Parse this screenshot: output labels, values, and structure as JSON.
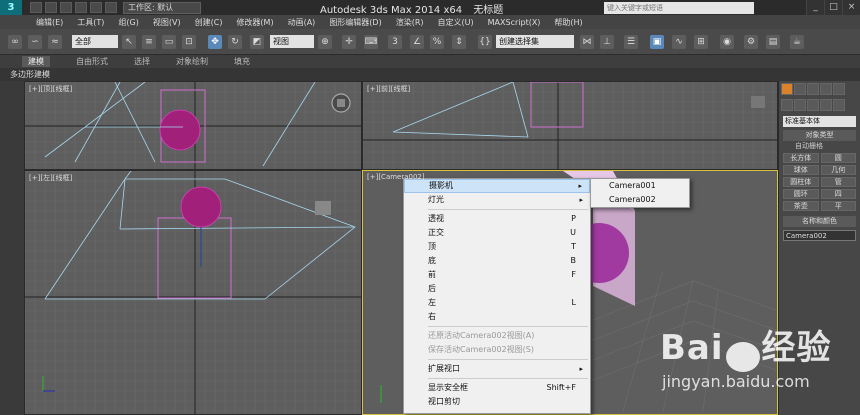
{
  "window": {
    "app_title": "Autodesk 3ds Max  2014 x64",
    "doc_title": "无标题",
    "workspace": "工作区: 默认",
    "search_placeholder": "键入关键字或短语",
    "logo": "3"
  },
  "menubar": [
    "编辑(E)",
    "工具(T)",
    "组(G)",
    "视图(V)",
    "创建(C)",
    "修改器(M)",
    "动画(A)",
    "图形编辑器(D)",
    "渲染(R)",
    "自定义(U)",
    "MAXScript(X)",
    "帮助(H)"
  ],
  "toolbar": {
    "filter": "全部",
    "view": "视图",
    "selection_set": "创建选择集"
  },
  "ribbon": {
    "tabs": [
      "建模",
      "自由形式",
      "选择",
      "对象绘制",
      "填充"
    ],
    "active": "建模",
    "sub": "多边形建模"
  },
  "viewports": {
    "top_left": "[+][顶][线框]",
    "top_right": "[+][前][线框]",
    "bottom_left": "[+][左][线框]",
    "bottom_right": "[+][Camera002]"
  },
  "context_menu": {
    "items": [
      {
        "label": "摄影机",
        "submenu": true,
        "highlighted": true
      },
      {
        "label": "灯光",
        "submenu": true
      },
      {
        "sep": true
      },
      {
        "label": "透视",
        "key": "P"
      },
      {
        "label": "正交",
        "key": "U"
      },
      {
        "label": "顶",
        "key": "T"
      },
      {
        "label": "底",
        "key": "B"
      },
      {
        "label": "前",
        "key": "F"
      },
      {
        "label": "后",
        "key": ""
      },
      {
        "label": "左",
        "key": "L"
      },
      {
        "label": "右",
        "key": ""
      },
      {
        "sep": true
      },
      {
        "label": "还原活动Camera002视图(A)",
        "disabled": true
      },
      {
        "label": "保存活动Camera002视图(S)",
        "disabled": true
      },
      {
        "sep": true
      },
      {
        "label": "扩展视口",
        "submenu": true
      },
      {
        "sep": true
      },
      {
        "label": "显示安全框",
        "key": "Shift+F"
      },
      {
        "label": "视口剪切"
      }
    ],
    "submenu": [
      "Camera001",
      "Camera002"
    ]
  },
  "command_panel": {
    "dropdown": "标准基本体",
    "section_object_type": "对象类型",
    "autogrid": "自动栅格",
    "buttons": [
      "长方体",
      "圆",
      "球体",
      "几何",
      "圆柱体",
      "管",
      "圆环",
      "四",
      "茶壶",
      "平"
    ],
    "section_name_color": "名称和颜色",
    "name_value": "Camera002"
  },
  "watermark": {
    "brand_left": "Bai",
    "brand_right": "经验",
    "url": "jingyan.baidu.com"
  }
}
